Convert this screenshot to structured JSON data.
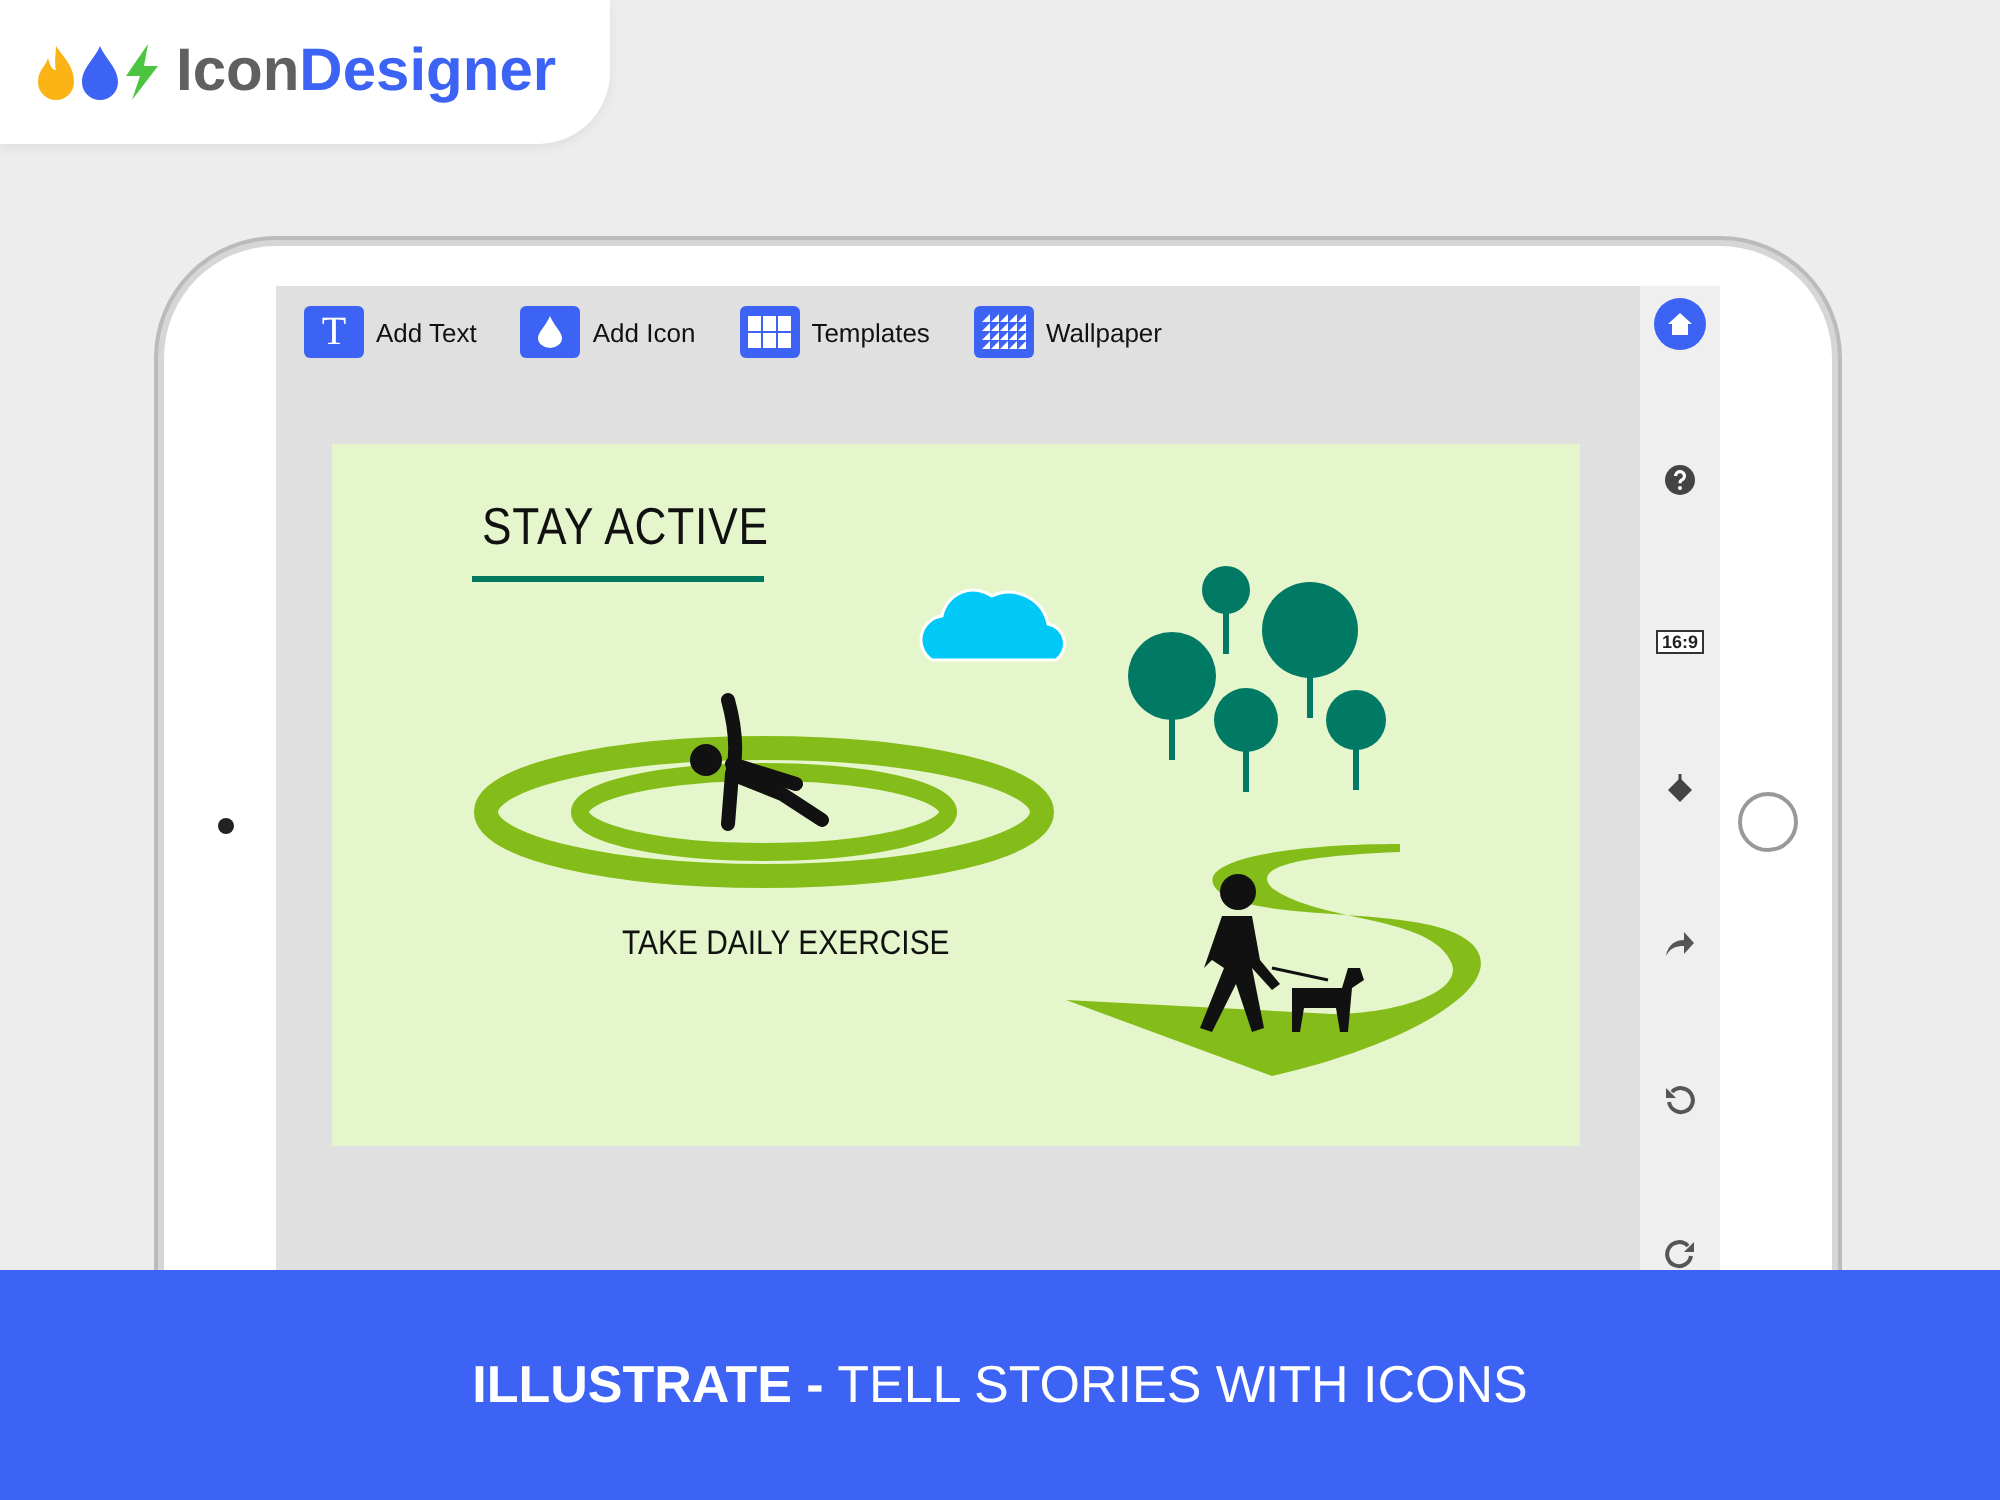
{
  "app_logo": {
    "word_1": "Icon",
    "word_2": "Designer"
  },
  "toolbar": [
    {
      "kind": "text",
      "icon_char": "T",
      "label": "Add Text"
    },
    {
      "kind": "icon",
      "label": "Add Icon"
    },
    {
      "kind": "templates",
      "label": "Templates"
    },
    {
      "kind": "wallpaper",
      "label": "Wallpaper"
    }
  ],
  "sidebar": [
    {
      "kind": "home"
    },
    {
      "kind": "help"
    },
    {
      "kind": "aspect",
      "label": "16:9"
    },
    {
      "kind": "fill"
    },
    {
      "kind": "share"
    },
    {
      "kind": "undo"
    },
    {
      "kind": "redo"
    }
  ],
  "canvas": {
    "title": "STAY ACTIVE",
    "caption": "TAKE DAILY EXERCISE"
  },
  "banner": "**ILLUSTRATE -** TELL STORIES WITH ICONS"
}
